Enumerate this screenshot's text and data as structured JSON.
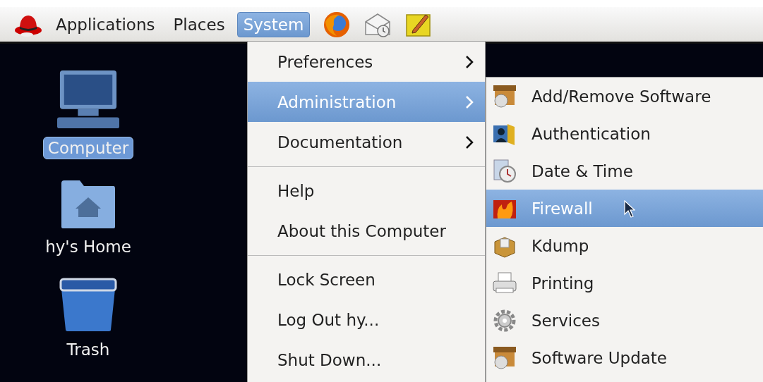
{
  "panel": {
    "menus": [
      {
        "label": "Applications",
        "selected": false
      },
      {
        "label": "Places",
        "selected": false
      },
      {
        "label": "System",
        "selected": true
      }
    ]
  },
  "desktop_icons": [
    {
      "label": "Computer",
      "selected": true
    },
    {
      "label": "hy's Home",
      "selected": false
    },
    {
      "label": "Trash",
      "selected": false
    }
  ],
  "system_menu": [
    {
      "kind": "item",
      "label": "Preferences",
      "submenu": true,
      "selected": false
    },
    {
      "kind": "item",
      "label": "Administration",
      "submenu": true,
      "selected": true
    },
    {
      "kind": "item",
      "label": "Documentation",
      "submenu": true,
      "selected": false
    },
    {
      "kind": "separator"
    },
    {
      "kind": "item",
      "label": "Help",
      "submenu": false,
      "selected": false
    },
    {
      "kind": "item",
      "label": "About this Computer",
      "submenu": false,
      "selected": false
    },
    {
      "kind": "separator"
    },
    {
      "kind": "item",
      "label": "Lock Screen",
      "submenu": false,
      "selected": false
    },
    {
      "kind": "item",
      "label": "Log Out hy...",
      "submenu": false,
      "selected": false
    },
    {
      "kind": "item",
      "label": "Shut Down...",
      "submenu": false,
      "selected": false
    }
  ],
  "administration_submenu": [
    {
      "label": "Add/Remove Software",
      "selected": false
    },
    {
      "label": "Authentication",
      "selected": false
    },
    {
      "label": "Date & Time",
      "selected": false
    },
    {
      "label": "Firewall",
      "selected": true
    },
    {
      "label": "Kdump",
      "selected": false
    },
    {
      "label": "Printing",
      "selected": false
    },
    {
      "label": "Services",
      "selected": false
    },
    {
      "label": "Software Update",
      "selected": false
    }
  ]
}
